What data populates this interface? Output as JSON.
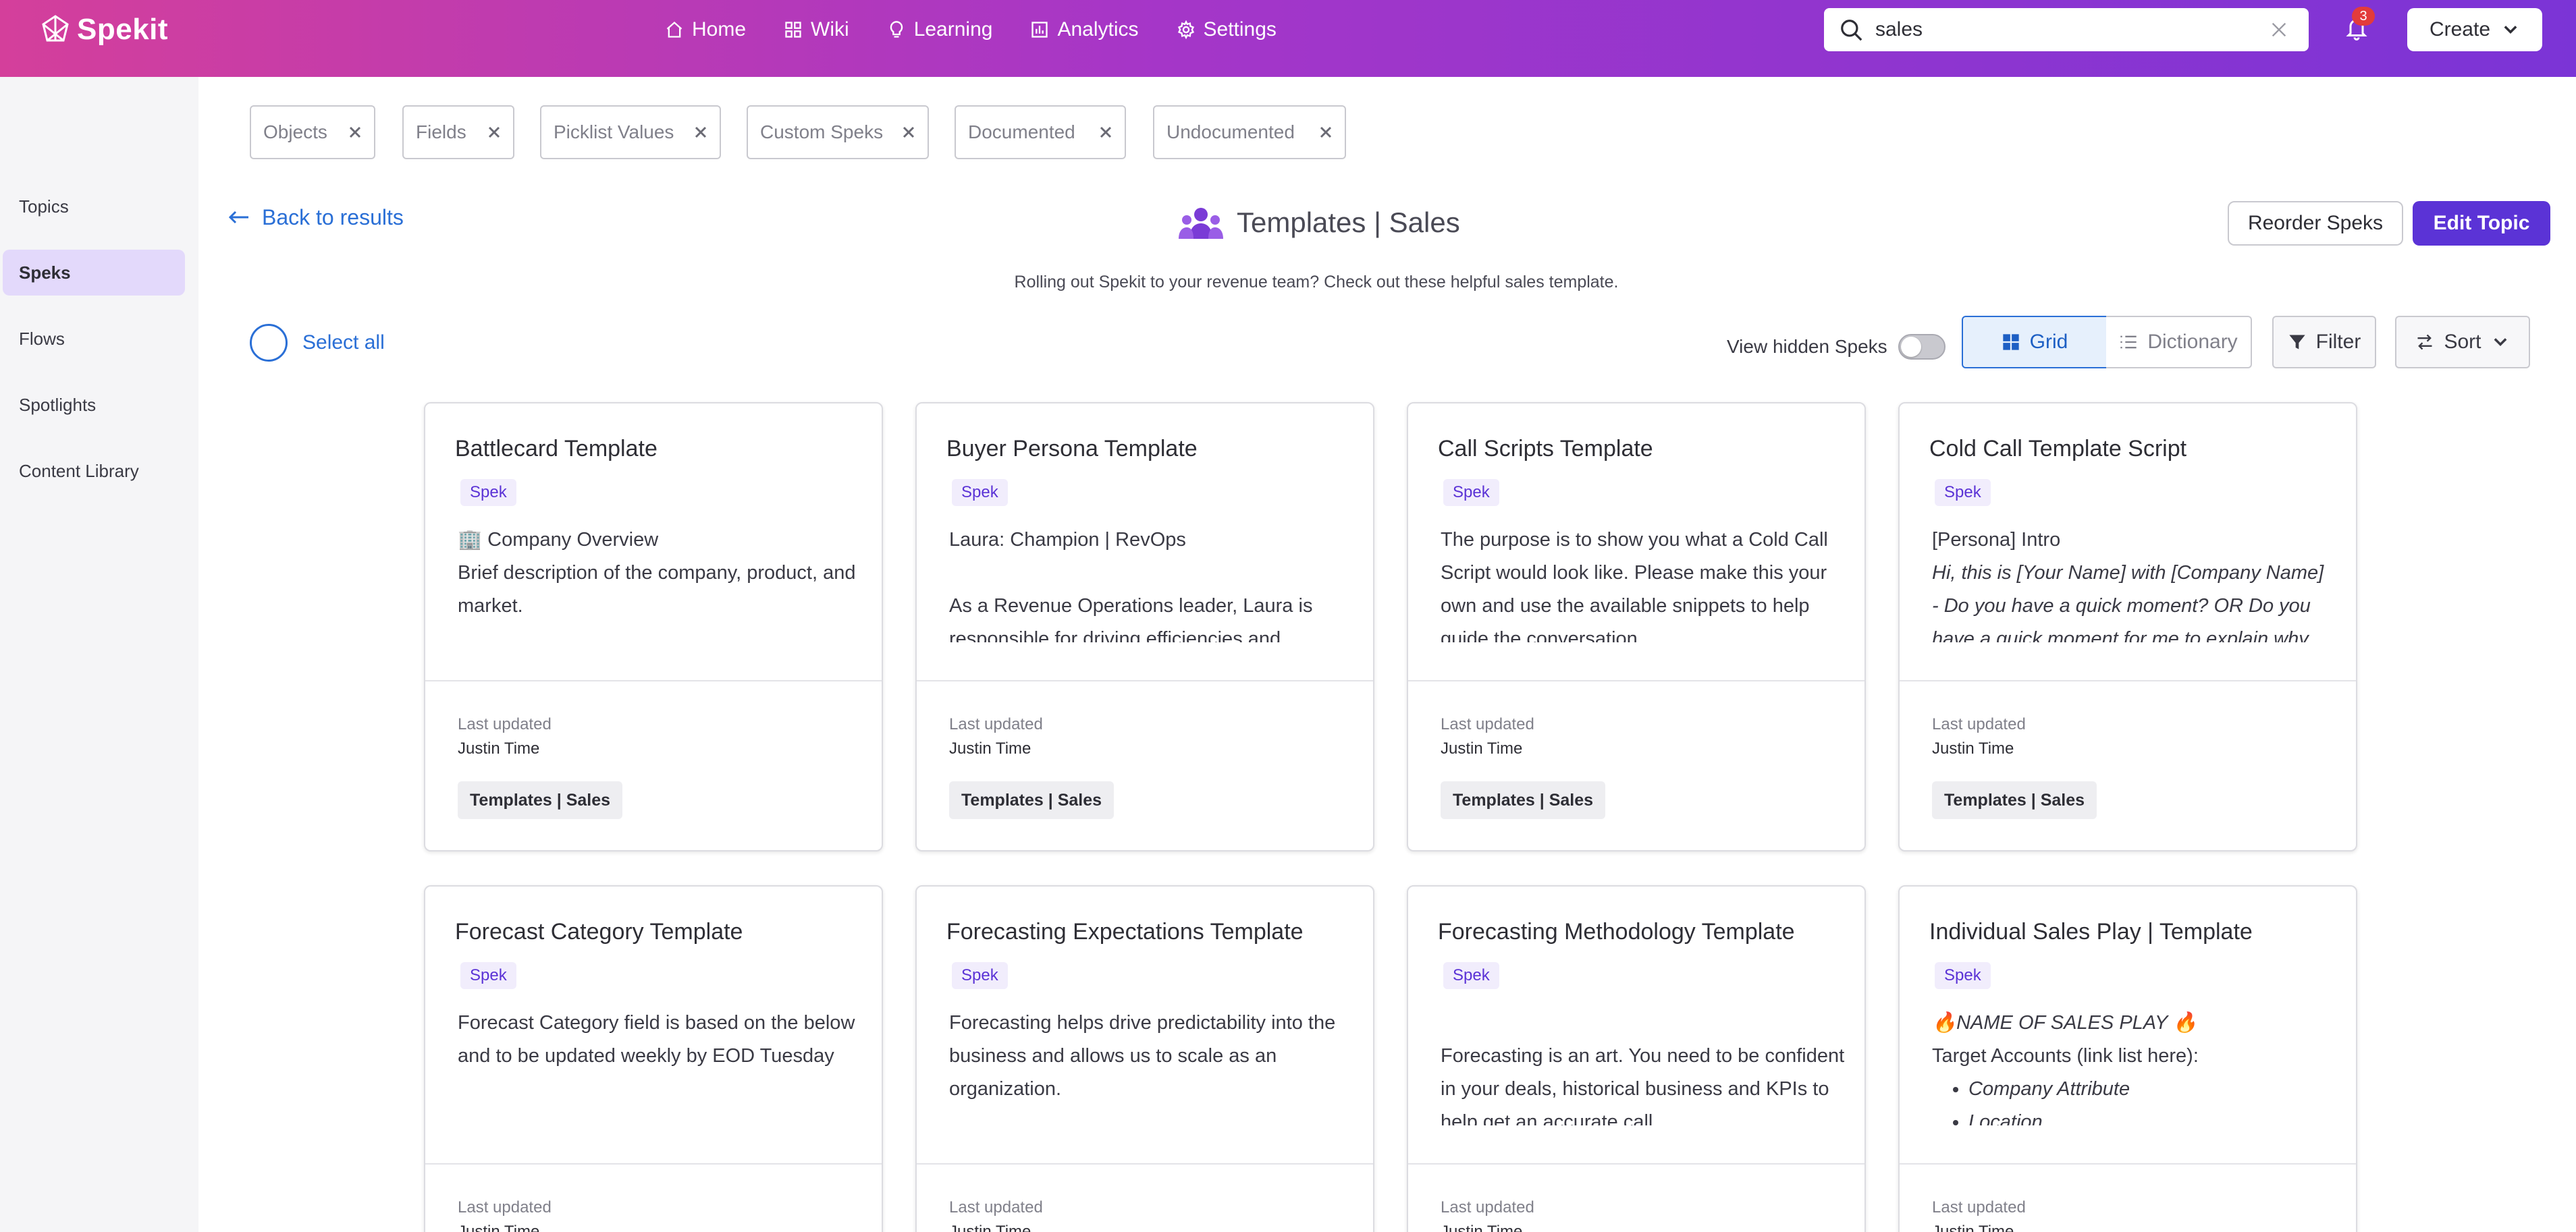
{
  "app": {
    "name": "Spekit"
  },
  "nav": {
    "items": [
      {
        "label": "Home",
        "icon": "home-icon"
      },
      {
        "label": "Wiki",
        "icon": "grid-icon"
      },
      {
        "label": "Learning",
        "icon": "lightbulb-icon"
      },
      {
        "label": "Analytics",
        "icon": "chart-icon"
      },
      {
        "label": "Settings",
        "icon": "gear-icon"
      }
    ],
    "search_value": "sales",
    "notifications_count": "3",
    "create_label": "Create"
  },
  "sidebar": {
    "items": [
      {
        "label": "Topics"
      },
      {
        "label": "Speks",
        "active": true
      },
      {
        "label": "Flows"
      },
      {
        "label": "Spotlights"
      },
      {
        "label": "Content Library"
      }
    ]
  },
  "filters": {
    "chips": [
      "Objects",
      "Fields",
      "Picklist Values",
      "Custom Speks",
      "Documented",
      "Undocumented"
    ]
  },
  "topic": {
    "back_label": "Back to results",
    "title": "Templates | Sales",
    "subtitle": "Rolling out Spekit to your revenue team? Check out these helpful sales template.",
    "reorder_label": "Reorder Speks",
    "edit_label": "Edit Topic"
  },
  "toolbar": {
    "select_all_label": "Select all",
    "view_hidden_label": "View hidden Speks",
    "view_hidden_on": false,
    "grid_label": "Grid",
    "dictionary_label": "Dictionary",
    "filter_label": "Filter",
    "sort_label": "Sort"
  },
  "cards": [
    {
      "title": "Battlecard Template",
      "tag": "Spek",
      "body": [
        "🏢 Company Overview",
        "Brief description of the company, product, and market."
      ],
      "last_updated_label": "Last updated",
      "author": "Justin Time",
      "topic": "Templates | Sales"
    },
    {
      "title": "Buyer Persona Template",
      "tag": "Spek",
      "body": [
        "Laura: Champion | RevOps",
        "",
        "As a Revenue Operations leader, Laura is responsible for driving efficiencies and"
      ],
      "last_updated_label": "Last updated",
      "author": "Justin Time",
      "topic": "Templates | Sales"
    },
    {
      "title": "Call Scripts Template",
      "tag": "Spek",
      "body": [
        "The purpose is to show you what a Cold Call Script would look like. Please make this your own and use the available snippets to help guide the conversation."
      ],
      "last_updated_label": "Last updated",
      "author": "Justin Time",
      "topic": "Templates | Sales"
    },
    {
      "title": "Cold Call Template Script",
      "tag": "Spek",
      "body": [
        "[Persona] Intro",
        "Hi, this is [Your Name] with [Company Name]",
        "-  Do you have a quick moment? OR Do you have a quick moment for me to explain why"
      ],
      "last_updated_label": "Last updated",
      "author": "Justin Time",
      "topic": "Templates | Sales"
    },
    {
      "title": "Forecast Category Template",
      "tag": "Spek",
      "body": [
        "Forecast Category field is based on the below and to be updated weekly by EOD Tuesday"
      ],
      "last_updated_label": "Last updated",
      "author": "Justin Time",
      "topic": ""
    },
    {
      "title": "Forecasting Expectations Template",
      "tag": "Spek",
      "body": [
        "Forecasting helps drive predictability into the business and allows us to scale as an organization."
      ],
      "last_updated_label": "Last updated",
      "author": "Justin Time",
      "topic": ""
    },
    {
      "title": "Forecasting Methodology Template",
      "tag": "Spek",
      "body": [
        "",
        "Forecasting is an art. You need to be confident in your deals, historical business and KPIs to help get an accurate call."
      ],
      "last_updated_label": "Last updated",
      "author": "Justin Time",
      "topic": ""
    },
    {
      "title": "Individual Sales Play | Template",
      "tag": "Spek",
      "body": [
        "🔥NAME OF SALES PLAY 🔥",
        "Target Accounts (link list here):",
        "Company Attribute",
        "Location"
      ],
      "last_updated_label": "Last updated",
      "author": "Justin Time",
      "topic": ""
    }
  ],
  "colors": {
    "gradient_start": "#d43f9b",
    "gradient_end": "#7b34d6",
    "primary": "#5b33d6",
    "link": "#2a6fd6",
    "badge": "#e23b3b"
  }
}
